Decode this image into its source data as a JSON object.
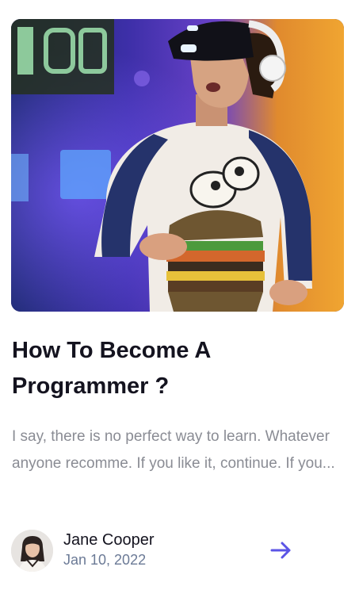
{
  "post": {
    "title": "How To Become A Programmer ?",
    "excerpt": "I say, there is no perfect way to learn. Whatever anyone recomme. If you like it, continue. If you...",
    "author_name": "Jane Cooper",
    "date": "Jan 10, 2022",
    "hero_image": "vr-headset-gamer-photo",
    "avatar_image": "author-portrait-photo",
    "read_more_icon": "arrow-right-icon"
  },
  "colors": {
    "title": "#14131f",
    "excerpt": "#8a8c94",
    "date": "#6b7a96",
    "accent": "#5b54e6"
  }
}
